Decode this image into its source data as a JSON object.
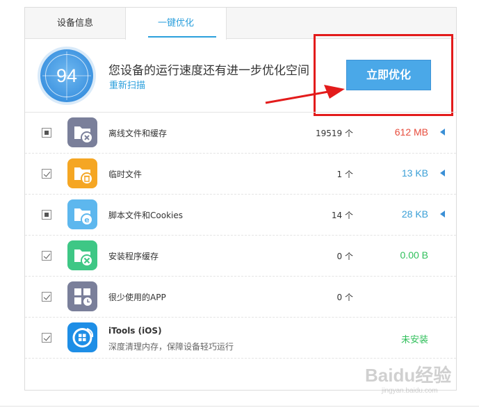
{
  "tabs": [
    {
      "label": "设备信息",
      "active": false
    },
    {
      "label": "一键优化",
      "active": true
    }
  ],
  "header": {
    "score": "94",
    "message": "您设备的运行速度还有进一步优化空间",
    "rescan_label": "重新扫描",
    "optimize_button": "立即优化"
  },
  "colors": {
    "accent": "#2b9fdc",
    "button": "#4aa8e8",
    "size_red": "#e74c3c",
    "size_blue": "#3a9fd6",
    "size_green": "#2fbf5a",
    "annotation_red": "#e31b1b"
  },
  "items": [
    {
      "name": "离线文件和缓存",
      "count": "19519 个",
      "size": "612 MB",
      "size_color": "#e74c3c",
      "check": "partial",
      "icon": "folder-delete-icon",
      "icon_color": "#7a7f9a",
      "expand": true
    },
    {
      "name": "临时文件",
      "count": "1 个",
      "size": "13 KB",
      "size_color": "#3a9fd6",
      "check": "checked",
      "icon": "folder-trash-icon",
      "icon_color": "#f5a623",
      "expand": true
    },
    {
      "name": "脚本文件和Cookies",
      "count": "14 个",
      "size": "28 KB",
      "size_color": "#3a9fd6",
      "check": "partial",
      "icon": "folder-browser-icon",
      "icon_color": "#5db7ee",
      "expand": true
    },
    {
      "name": "安装程序缓存",
      "count": "0 个",
      "size": "0.00 B",
      "size_color": "#2fbf5a",
      "check": "checked",
      "icon": "folder-tools-icon",
      "icon_color": "#3ec785",
      "expand": false
    },
    {
      "name": "很少使用的APP",
      "count": "0 个",
      "size": "",
      "size_color": "#3a9fd6",
      "check": "checked",
      "icon": "apps-clock-icon",
      "icon_color": "#7a7f9a",
      "expand": false
    }
  ],
  "itools": {
    "name": "iTools (iOS)",
    "description": "深度清理内存，保障设备轻巧运行",
    "status": "未安装",
    "status_color": "#2fbf5a",
    "check": "checked",
    "icon": "itools-icon"
  },
  "watermark": {
    "main": "Baidu经验",
    "sub": "jingyan.baidu.com"
  }
}
